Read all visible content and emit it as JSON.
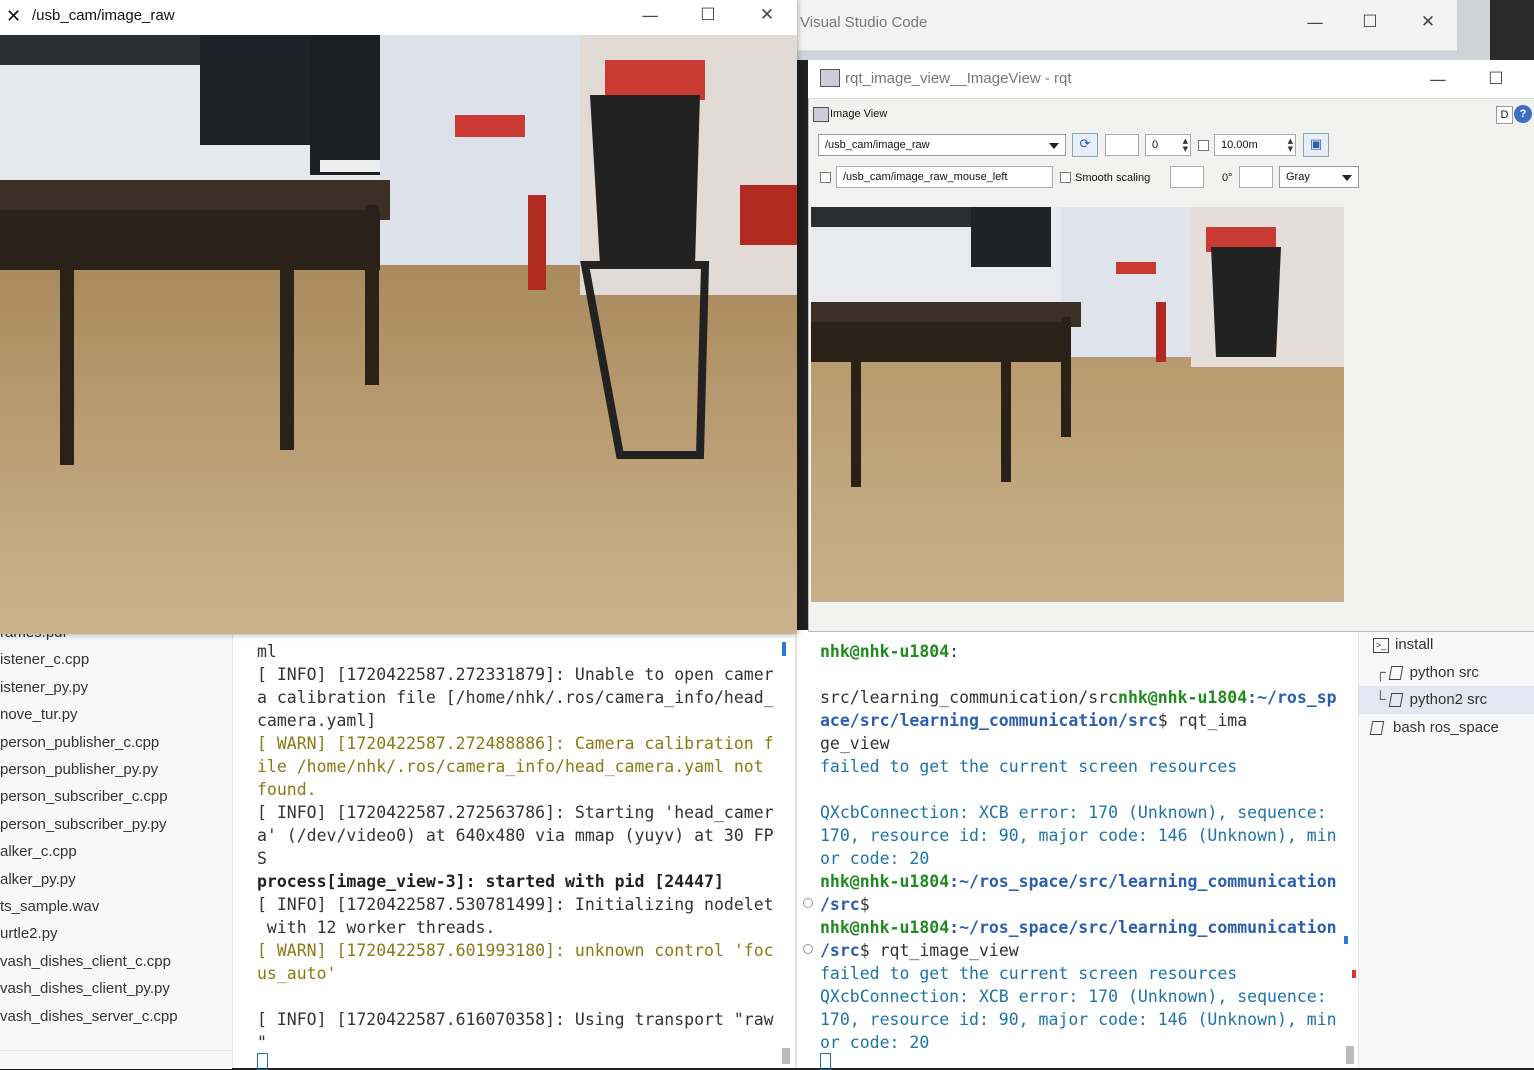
{
  "vscode": {
    "title": "Visual Studio Code",
    "minimize": "—",
    "maximize": "☐",
    "close": "✕"
  },
  "cam_window": {
    "title": "/usb_cam/image_raw",
    "minimize": "—",
    "maximize": "☐",
    "close": "✕"
  },
  "rqt_window": {
    "title": "rqt_image_view__ImageView - rqt",
    "plugin_title": "Image View",
    "help_buttons": [
      "D",
      "?"
    ],
    "topic_select": "/usb_cam/image_raw",
    "spin_value": "0",
    "max_range": "10.00m",
    "mouse_topic": "/usb_cam/image_raw_mouse_left",
    "smooth_scaling_label": "Smooth scaling",
    "rotation": "0°",
    "color_scheme": "Gray",
    "minimize": "—",
    "maximize": "☐"
  },
  "explorer": {
    "items": [
      "rames.pdf",
      "istener_c.cpp",
      "istener_py.py",
      "nove_tur.py",
      "person_publisher_c.cpp",
      "person_publisher_py.py",
      "person_subscriber_c.cpp",
      "person_subscriber_py.py",
      "alker_c.cpp",
      "alker_py.py",
      "ts_sample.wav",
      "urtle2.py",
      "vash_dishes_client_c.cpp",
      "vash_dishes_client_py.py",
      "vash_dishes_server_c.cpp"
    ]
  },
  "terminal_left": {
    "lines": [
      {
        "text": "ml",
        "style": "info"
      },
      {
        "text": "[ INFO] [1720422587.272331879]: Unable to open camer",
        "style": "info"
      },
      {
        "text": "a calibration file [/home/nhk/.ros/camera_info/head_",
        "style": "info"
      },
      {
        "text": "camera.yaml]",
        "style": "info"
      },
      {
        "text": "[ WARN] [1720422587.272488886]: Camera calibration f",
        "style": "warn"
      },
      {
        "text": "ile /home/nhk/.ros/camera_info/head_camera.yaml not",
        "style": "warn"
      },
      {
        "text": "found.",
        "style": "warn"
      },
      {
        "text": "[ INFO] [1720422587.272563786]: Starting 'head_camer",
        "style": "info"
      },
      {
        "text": "a' (/dev/video0) at 640x480 via mmap (yuyv) at 30 FP",
        "style": "info"
      },
      {
        "text": "S",
        "style": "info"
      },
      {
        "text": "process[image_view-3]: started with pid [24447]",
        "style": "bold"
      },
      {
        "text": "[ INFO] [1720422587.530781499]: Initializing nodelet",
        "style": "info"
      },
      {
        "text": " with 12 worker threads.",
        "style": "info"
      },
      {
        "text": "[ WARN] [1720422587.601993180]: unknown control 'foc",
        "style": "warn"
      },
      {
        "text": "us_auto'",
        "style": "warn"
      },
      {
        "text": "",
        "style": "info"
      },
      {
        "text": "[ INFO] [1720422587.616070358]: Using transport \"raw",
        "style": "info"
      },
      {
        "text": "\"",
        "style": "info"
      }
    ]
  },
  "terminal_right": {
    "line1_user": "nhk@nhk-u1804",
    "line1_rest": ":",
    "line2_prefix": "src/learning_communication/src",
    "line2_user": "nhk@nhk-u1804",
    "line2_path": ":~/ros_sp",
    "line3_path": "ace/src/learning_communication/src",
    "line3_cmd": "$ rqt_ima",
    "line4": "ge_view",
    "line5": "failed to get the current screen resources",
    "line6": "QXcbConnection: XCB error: 170 (Unknown), sequence:",
    "line7": "170, resource id: 90, major code: 146 (Unknown), min",
    "line8": "or code: 20",
    "line9_user": "nhk@nhk-u1804",
    "line9_path": ":~/ros_space/src/learning_communication",
    "line10_path": "/src",
    "line10_cmd": "$",
    "line11_user": "nhk@nhk-u1804",
    "line11_path": ":~/ros_space/src/learning_communication",
    "line12_path": "/src",
    "line12_cmd": "$ rqt_image_view",
    "line13": "failed to get the current screen resources",
    "line14": "QXcbConnection: XCB error: 170 (Unknown), sequence:",
    "line15": "170, resource id: 90, major code: 146 (Unknown), min",
    "line16": "or code: 20"
  },
  "terminal_list": {
    "items": [
      {
        "label": "install"
      },
      {
        "label": "python  src"
      },
      {
        "label": "python2  src"
      },
      {
        "label": "bash  ros_space"
      }
    ]
  },
  "colors": {
    "green_user": "#1f8b1f",
    "blue_path": "#2c5fb0",
    "warn": "#8a7a14",
    "teal": "#1e73a8"
  }
}
